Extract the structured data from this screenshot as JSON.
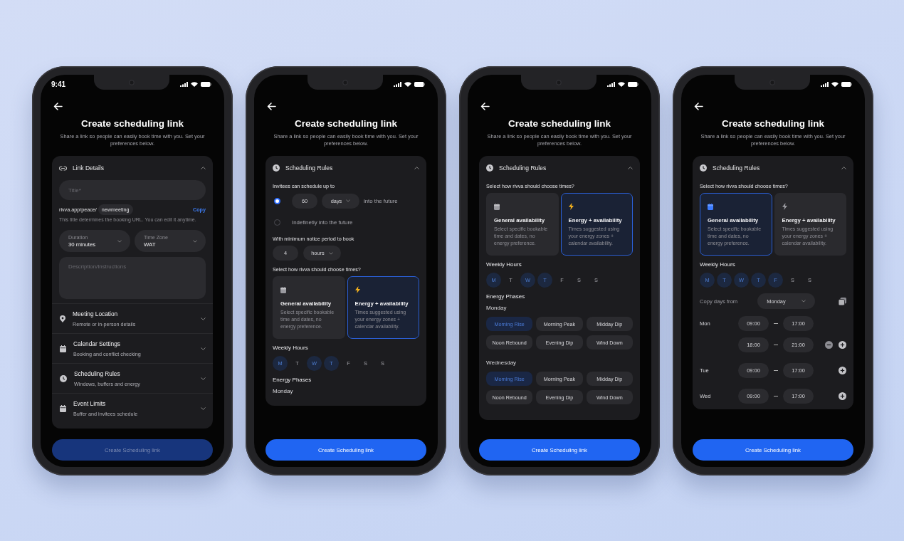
{
  "phones": [
    {
      "status_time": "9:41",
      "title": "Create scheduling link",
      "subtitle": "Share a link so people can easily book time with you. Set your preferences below.",
      "panel": {
        "kind": "link",
        "title": "Link Details",
        "expanded": true,
        "blocks": [
          {
            "kind": "details",
            "title_placeholder": "Title*",
            "url_prefix": "rivva.app/peace/",
            "slug": "newmeeting",
            "copy": "Copy",
            "hint": "This title determines the booking URL. You can edit it anytime.",
            "selects": [
              {
                "label": "Duration",
                "value": "30 minutes"
              },
              {
                "label": "Time Zone",
                "value": "WAT"
              }
            ],
            "description_placeholder": "Description/Instructions"
          }
        ]
      },
      "sections": [
        {
          "kind": "location",
          "title": "Meeting Location",
          "subtitle": "Remote or in-person details",
          "expanded": false
        },
        {
          "kind": "calendar",
          "title": "Calendar Settings",
          "subtitle": "Booking and conflict checking",
          "expanded": false
        },
        {
          "kind": "rules",
          "title": "Scheduling Rules",
          "subtitle": "Windows, buffers and energy",
          "expanded": false
        },
        {
          "kind": "limits",
          "title": "Event Limits",
          "subtitle": "Buffer and invitees schedule",
          "expanded": false
        }
      ],
      "button": {
        "label": "Create Scheduling link",
        "disabled": true
      }
    },
    {
      "title": "Create scheduling link",
      "subtitle": "Share a link so people can easily book time with you. Set your preferences below.",
      "panel": {
        "kind": "rules",
        "title": "Scheduling Rules",
        "expanded": true,
        "blocks": [
          {
            "kind": "limit",
            "label": "Invitees can schedule up to",
            "options": [
              {
                "kind": "amount",
                "selected": true,
                "value": "60",
                "unit": "days",
                "suffix": "into the future"
              },
              {
                "kind": "text",
                "selected": false,
                "label": "Indefinetly into the future"
              }
            ]
          },
          {
            "kind": "notice",
            "label": "With minimum notice period to book",
            "value": "4",
            "unit": "hours"
          },
          {
            "kind": "modes",
            "label": "Select how rivva should choose times?",
            "options": [
              {
                "kind": "general",
                "title": "General availability",
                "text": "Select specific bookable time and dates, no energy preference.",
                "selected": false
              },
              {
                "kind": "energy",
                "title": "Energy + availability",
                "text": "Times suggested using your energy zones + calendar availability.",
                "selected": true
              }
            ]
          },
          {
            "kind": "weekly",
            "label": "Weekly Hours",
            "days": [
              {
                "label": "M",
                "selected": true
              },
              {
                "label": "T",
                "selected": false
              },
              {
                "label": "W",
                "selected": true
              },
              {
                "label": "T",
                "selected": true
              },
              {
                "label": "F",
                "selected": false
              },
              {
                "label": "S",
                "selected": false
              },
              {
                "label": "S",
                "selected": false
              }
            ]
          },
          {
            "kind": "phases",
            "label": "Energy Phases",
            "days": [
              {
                "name": "Monday"
              }
            ]
          }
        ]
      },
      "button": {
        "label": "Create Scheduling link",
        "disabled": false
      }
    },
    {
      "title": "Create scheduling link",
      "subtitle": "Share a link so people can easily book time with you. Set your preferences below.",
      "panel": {
        "kind": "rules",
        "title": "Scheduling Rules",
        "expanded": true,
        "blocks": [
          {
            "kind": "modes",
            "label": "Select how rivva should choose times?",
            "options": [
              {
                "kind": "general",
                "title": "General availability",
                "text": "Select specific bookable time and dates, no energy preference.",
                "selected": false
              },
              {
                "kind": "energy",
                "title": "Energy + availability",
                "text": "Times suggested using your energy zones + calendar availability.",
                "selected": true
              }
            ]
          },
          {
            "kind": "weekly",
            "label": "Weekly Hours",
            "days": [
              {
                "label": "M",
                "selected": true
              },
              {
                "label": "T",
                "selected": false
              },
              {
                "label": "W",
                "selected": true
              },
              {
                "label": "T",
                "selected": true
              },
              {
                "label": "F",
                "selected": false
              },
              {
                "label": "S",
                "selected": false
              },
              {
                "label": "S",
                "selected": false
              }
            ]
          },
          {
            "kind": "phases",
            "label": "Energy Phases",
            "days": [
              {
                "name": "Monday",
                "phases": [
                  {
                    "label": "Morning Rise",
                    "selected": true
                  },
                  {
                    "label": "Morning Peak",
                    "selected": false
                  },
                  {
                    "label": "Midday Dip",
                    "selected": false
                  },
                  {
                    "label": "Noon Rebound",
                    "selected": false
                  },
                  {
                    "label": "Evening Dip",
                    "selected": false
                  },
                  {
                    "label": "Wind Down",
                    "selected": false
                  }
                ]
              },
              {
                "name": "Wednesday",
                "phases": [
                  {
                    "label": "Morning Rise",
                    "selected": true
                  },
                  {
                    "label": "Morning Peak",
                    "selected": false
                  },
                  {
                    "label": "Midday Dip",
                    "selected": false
                  },
                  {
                    "label": "Noon Rebound",
                    "selected": false
                  },
                  {
                    "label": "Evening Dip",
                    "selected": false
                  },
                  {
                    "label": "Wind Down",
                    "selected": false
                  }
                ]
              }
            ]
          }
        ]
      },
      "button": {
        "label": "Create Scheduling link",
        "disabled": false
      }
    },
    {
      "title": "Create scheduling link",
      "subtitle": "Share a link so people can easily book time with you. Set your preferences below.",
      "panel": {
        "kind": "rules",
        "title": "Scheduling Rules",
        "expanded": true,
        "blocks": [
          {
            "kind": "modes",
            "label": "Select how rivva should choose times?",
            "options": [
              {
                "kind": "general",
                "title": "General availability",
                "text": "Select specific bookable time and dates, no energy preference.",
                "selected": true
              },
              {
                "kind": "energy",
                "title": "Energy + availability",
                "text": "Times suggested using your energy zones + calendar availability.",
                "selected": false
              }
            ]
          },
          {
            "kind": "weekly",
            "label": "Weekly Hours",
            "days": [
              {
                "label": "M",
                "selected": true
              },
              {
                "label": "T",
                "selected": true
              },
              {
                "label": "W",
                "selected": true
              },
              {
                "label": "T",
                "selected": true
              },
              {
                "label": "F",
                "selected": true
              },
              {
                "label": "S",
                "selected": false
              },
              {
                "label": "S",
                "selected": false
              }
            ]
          },
          {
            "kind": "copy",
            "label": "Copy days from",
            "value": "Monday"
          },
          {
            "kind": "hours",
            "days": [
              {
                "name": "Mon",
                "ranges": [
                  {
                    "start": "09:00",
                    "end": "17:00"
                  },
                  {
                    "start": "18:00",
                    "end": "21:00",
                    "actions": [
                      {
                        "kind": "remove"
                      },
                      {
                        "kind": "add"
                      }
                    ]
                  }
                ]
              },
              {
                "name": "Tue",
                "ranges": [
                  {
                    "start": "09:00",
                    "end": "17:00",
                    "actions": [
                      {
                        "kind": "add"
                      }
                    ]
                  }
                ]
              },
              {
                "name": "Wed",
                "ranges": [
                  {
                    "start": "09:00",
                    "end": "17:00",
                    "actions": [
                      {
                        "kind": "add"
                      }
                    ]
                  }
                ]
              }
            ]
          }
        ]
      },
      "button": {
        "label": "Create Scheduling link",
        "disabled": false
      }
    }
  ]
}
